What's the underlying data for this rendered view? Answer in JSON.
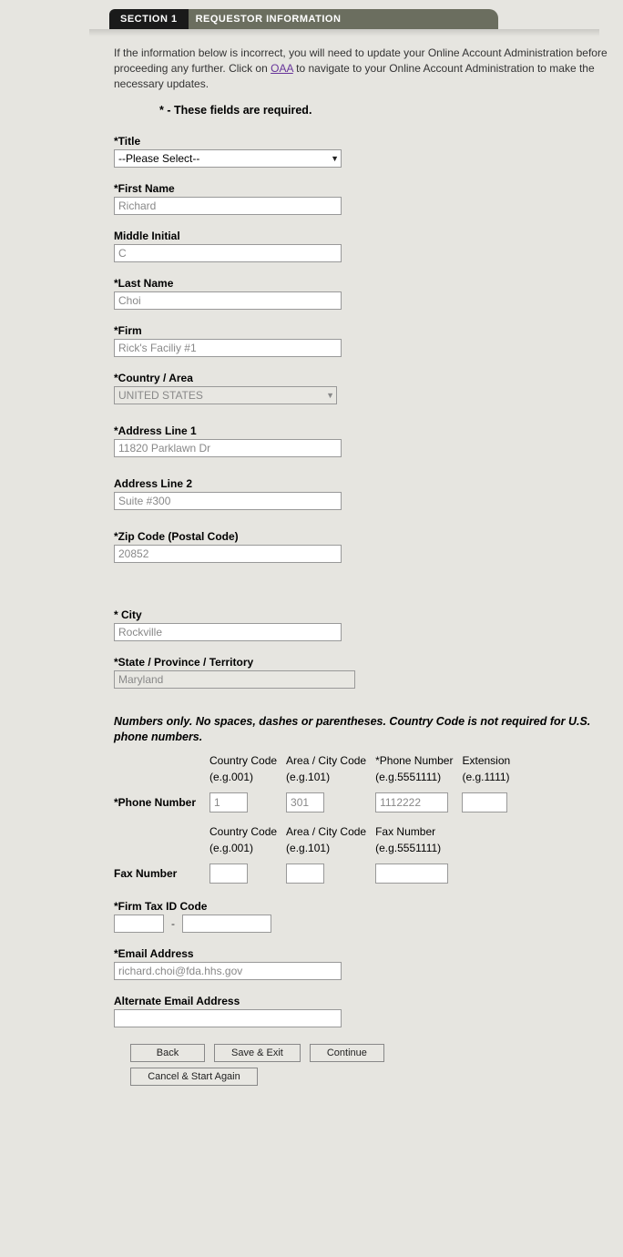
{
  "header": {
    "section": "SECTION 1",
    "title": "REQUESTOR INFORMATION"
  },
  "instructions": {
    "prefix": "If the information below is incorrect, you will need to update your Online Account Administration before proceeding any further. Click on ",
    "link": "OAA",
    "suffix": " to navigate to your Online Account Administration to make the necessary updates."
  },
  "required_note": "* - These fields are required.",
  "fields": {
    "title": {
      "label": "*Title",
      "value": "--Please Select--"
    },
    "first_name": {
      "label": "*First Name",
      "value": "Richard"
    },
    "middle_initial": {
      "label": "Middle Initial",
      "value": "C"
    },
    "last_name": {
      "label": "*Last Name",
      "value": "Choi"
    },
    "firm": {
      "label": "*Firm",
      "value": "Rick's Faciliy #1"
    },
    "country": {
      "label": "*Country / Area",
      "value": "UNITED STATES"
    },
    "address1": {
      "label": "*Address Line 1",
      "value": "11820 Parklawn Dr"
    },
    "address2": {
      "label": "Address Line 2",
      "value": "Suite #300"
    },
    "zip": {
      "label": "*Zip Code (Postal Code)",
      "value": "20852"
    },
    "city": {
      "label": "* City",
      "value": "Rockville"
    },
    "state": {
      "label": "*State / Province / Territory",
      "value": "Maryland"
    },
    "firm_tax": {
      "label": "*Firm Tax ID Code"
    },
    "email": {
      "label": "*Email Address",
      "value": "richard.choi@fda.hhs.gov"
    },
    "alt_email": {
      "label": "Alternate Email Address",
      "value": ""
    }
  },
  "phone_note": "Numbers only. No spaces, dashes or parentheses. Country Code is not required for U.S. phone numbers.",
  "phone_headers": {
    "country": "Country Code",
    "area": "Area / City Code",
    "number": "*Phone Number",
    "ext": "Extension"
  },
  "phone_hints": {
    "country": "(e.g.001)",
    "area": "(e.g.101)",
    "number": "(e.g.5551111)",
    "ext": "(e.g.1111)"
  },
  "phone": {
    "label": "*Phone Number",
    "cc": "1",
    "area": "301",
    "num": "1112222",
    "ext": ""
  },
  "fax_headers": {
    "country": "Country Code",
    "area": "Area / City Code",
    "number": "Fax Number"
  },
  "fax_hints": {
    "country": "(e.g.001)",
    "area": "(e.g.101)",
    "number": "(e.g.5551111)"
  },
  "fax": {
    "label": "Fax Number",
    "cc": "",
    "area": "",
    "num": ""
  },
  "buttons": {
    "back": "Back",
    "save_exit": "Save & Exit",
    "continue": "Continue",
    "cancel": "Cancel & Start Again"
  },
  "tax_sep": "-"
}
